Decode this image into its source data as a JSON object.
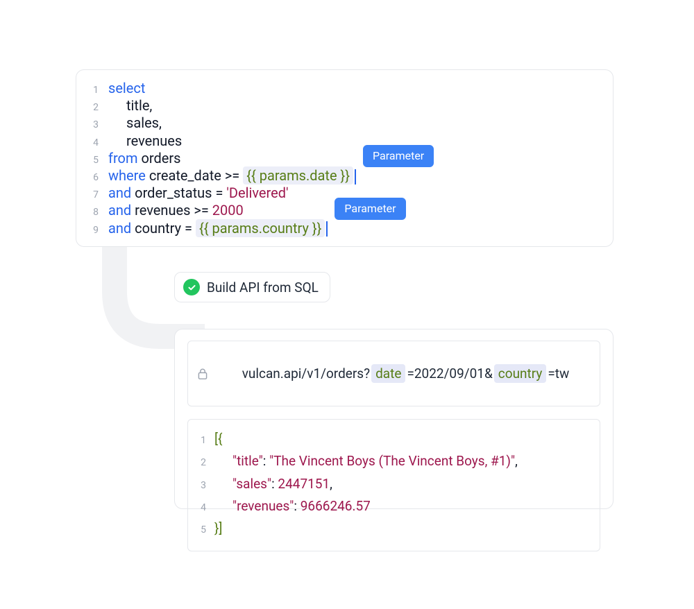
{
  "sql": {
    "lines": [
      {
        "n": "1",
        "tokens": [
          [
            "kw",
            "select"
          ]
        ]
      },
      {
        "n": "2",
        "indent": 1,
        "tokens": [
          [
            "id",
            "title"
          ],
          [
            "op",
            ","
          ]
        ]
      },
      {
        "n": "3",
        "indent": 1,
        "tokens": [
          [
            "id",
            "sales"
          ],
          [
            "op",
            ","
          ]
        ]
      },
      {
        "n": "4",
        "indent": 1,
        "tokens": [
          [
            "id",
            "revenues"
          ]
        ]
      },
      {
        "n": "5",
        "tokens": [
          [
            "kw",
            "from"
          ],
          [
            "sp",
            " "
          ],
          [
            "id",
            "orders"
          ]
        ]
      },
      {
        "n": "6",
        "tokens": [
          [
            "kw",
            "where"
          ],
          [
            "sp",
            " "
          ],
          [
            "id",
            "create_date"
          ],
          [
            "sp",
            " "
          ],
          [
            "op",
            ">="
          ],
          [
            "sp",
            " "
          ],
          [
            "param",
            "{{ params.date }}"
          ],
          [
            "cursor",
            ""
          ]
        ],
        "tag": "Parameter"
      },
      {
        "n": "7",
        "tokens": [
          [
            "kw",
            "and"
          ],
          [
            "sp",
            " "
          ],
          [
            "id",
            "order_status"
          ],
          [
            "sp",
            " "
          ],
          [
            "op",
            "="
          ],
          [
            "sp",
            " "
          ],
          [
            "str",
            "'Delivered'"
          ]
        ]
      },
      {
        "n": "8",
        "tokens": [
          [
            "kw",
            "and"
          ],
          [
            "sp",
            " "
          ],
          [
            "id",
            "revenues"
          ],
          [
            "sp",
            " "
          ],
          [
            "op",
            ">="
          ],
          [
            "sp",
            " "
          ],
          [
            "num",
            "2000"
          ]
        ]
      },
      {
        "n": "9",
        "tokens": [
          [
            "kw",
            "and"
          ],
          [
            "sp",
            " "
          ],
          [
            "id",
            "country"
          ],
          [
            "sp",
            " "
          ],
          [
            "op",
            "="
          ],
          [
            "sp",
            " "
          ],
          [
            "param",
            "{{ params.country }}"
          ],
          [
            "cursor",
            ""
          ]
        ],
        "tag": "Parameter"
      }
    ]
  },
  "build_badge": {
    "label": "Build API from SQL"
  },
  "url": {
    "prefix": "vulcan.api/v1/orders?",
    "p1key": "date",
    "p1rest": "=2022/09/01&",
    "p2key": "country",
    "p2rest": "=tw"
  },
  "json": {
    "lines": [
      {
        "n": "1",
        "tokens": [
          [
            "jpunc",
            "[{"
          ]
        ]
      },
      {
        "n": "2",
        "indent": 1,
        "tokens": [
          [
            "jkey",
            "\"title\""
          ],
          [
            "op",
            ": "
          ],
          [
            "jstr",
            "\"The Vincent Boys (The Vincent Boys, #1)\""
          ],
          [
            "op",
            ","
          ]
        ]
      },
      {
        "n": "3",
        "indent": 1,
        "tokens": [
          [
            "jkey",
            "\"sales\""
          ],
          [
            "op",
            ": "
          ],
          [
            "jnum",
            "2447151"
          ],
          [
            "op",
            ","
          ]
        ]
      },
      {
        "n": "4",
        "indent": 1,
        "tokens": [
          [
            "jkey",
            "\"revenues\""
          ],
          [
            "op",
            ": "
          ],
          [
            "jnum",
            "9666246.57"
          ]
        ]
      },
      {
        "n": "5",
        "tokens": [
          [
            "jpunc",
            "}]"
          ]
        ]
      }
    ]
  }
}
